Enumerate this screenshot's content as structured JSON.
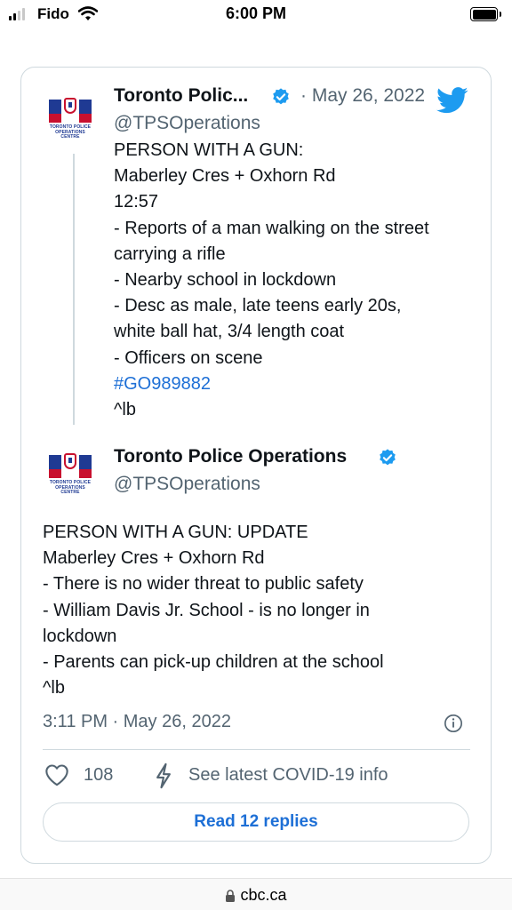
{
  "status_bar": {
    "carrier": "Fido",
    "time": "6:00 PM"
  },
  "tweet_1": {
    "display_name": "Toronto Polic...",
    "handle": "@TPSOperations",
    "date": "· May 26, 2022",
    "avatar_caption": [
      "TORONTO POLICE",
      "OPERATIONS",
      "CENTRE"
    ],
    "lines": [
      "PERSON WITH A GUN:",
      "Maberley Cres + Oxhorn Rd",
      "12:57",
      "- Reports of a man walking on the street",
      "carrying a rifle",
      "- Nearby school in lockdown",
      "- Desc as male, late teens early 20s,",
      "white ball hat, 3/4 length coat",
      "- Officers on scene"
    ],
    "hashtag": "#GO989882",
    "signoff": "^lb"
  },
  "tweet_2": {
    "display_name": "Toronto Police Operations",
    "handle": "@TPSOperations",
    "avatar_caption": [
      "TORONTO POLICE",
      "OPERATIONS",
      "CENTRE"
    ],
    "lines": [
      "PERSON WITH A GUN: UPDATE",
      "Maberley Cres + Oxhorn Rd",
      "- There is no wider threat to public safety",
      "- William Davis Jr. School - is no longer in",
      "lockdown",
      "- Parents can pick-up children at  the school",
      "^lb"
    ],
    "timestamp": "3:11 PM · May 26, 2022"
  },
  "actions": {
    "like_count": "108",
    "covid_link": "See latest COVID-19 info",
    "replies_button": "Read 12 replies"
  },
  "browser": {
    "url": "cbc.ca"
  },
  "colors": {
    "link_blue": "#1d6fd6",
    "verified_blue": "#1d9bf0",
    "muted_gray": "#536471",
    "border": "#cfd9de"
  },
  "icons": [
    "signal-icon",
    "wifi-icon",
    "battery-icon",
    "verified-icon",
    "twitter-bird-icon",
    "info-icon",
    "heart-icon",
    "bolt-icon",
    "lock-icon"
  ]
}
